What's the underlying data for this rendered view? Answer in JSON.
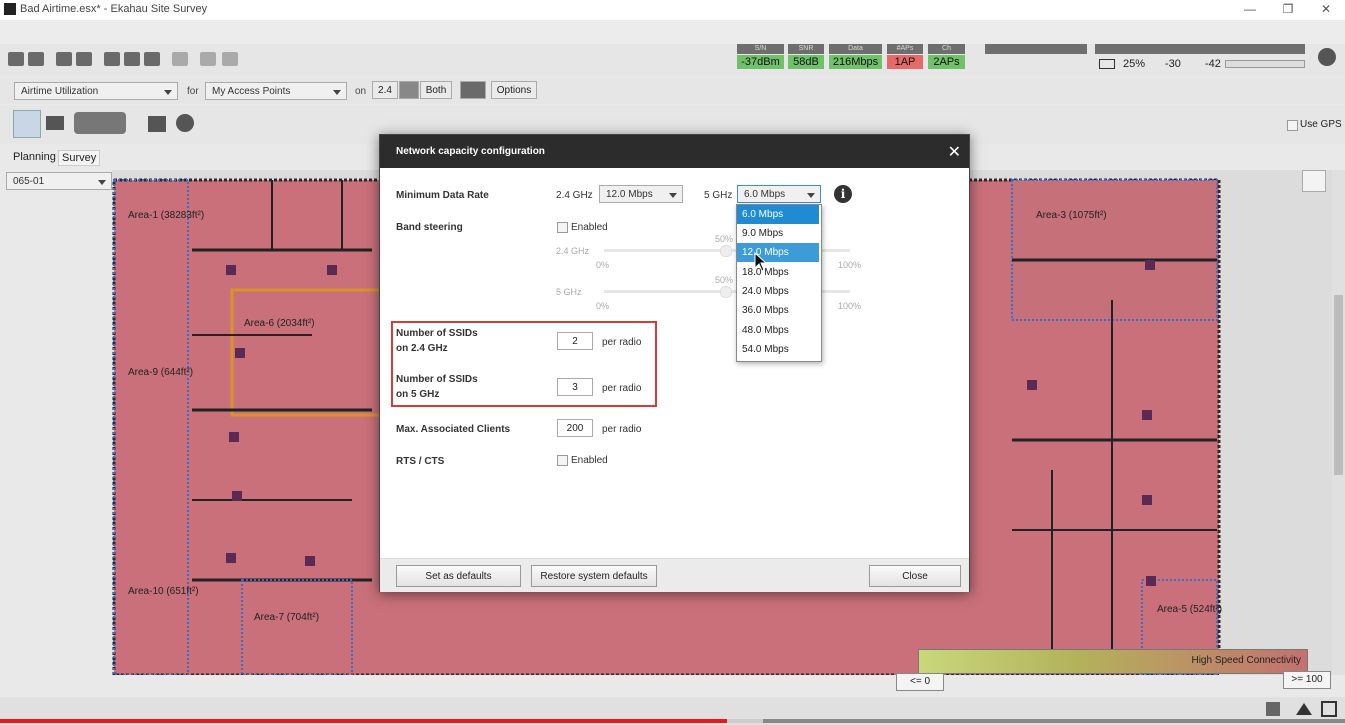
{
  "window": {
    "title": "Bad Airtime.esx* - Ekahau Site Survey",
    "minimize": "—",
    "maximize": "❐",
    "close": "✕"
  },
  "status": {
    "snr_label": "S/N",
    "snr_value": "-37dBm",
    "snr2_label": "SNR",
    "snr2_value": "58dB",
    "data_label": "Data",
    "data_value": "216Mbps",
    "aps_label": "#APs",
    "aps_value": "1AP",
    "ch_label": "Ch",
    "ch_value": "2APs",
    "right": {
      "battery": "25%",
      "rssi24": "-30",
      "rssi5": "-42"
    }
  },
  "filter": {
    "view": "Airtime Utilization",
    "for_label": "for",
    "scope": "My Access Points",
    "on_label": "on",
    "band_24": "2.4",
    "band_both": "Both",
    "options": "Options"
  },
  "use_gps": "Use GPS",
  "left": {
    "tab_planning": "Planning",
    "tab_survey": "Survey",
    "floor": "065-01",
    "add": "+"
  },
  "map": {
    "areas": [
      "Area-1 (38283ft²)",
      "Area-3 (1075ft²)",
      "Area-6 (2034ft²)",
      "Area-9 (644ft²)",
      "Area-10 (651ft²)",
      "Area-7 (704ft²)",
      "Area-5 (524ft²)"
    ]
  },
  "legend": {
    "label": "High Speed Connectivity",
    "low": "<= 0",
    "high": ">= 100"
  },
  "dialog": {
    "title": "Network capacity configuration",
    "close": "✕",
    "min_rate_label": "Minimum Data Rate",
    "band24": "2.4 GHz",
    "band24_value": "12.0 Mbps",
    "band5": "5 GHz",
    "band5_value": "6.0 Mbps",
    "info": "i",
    "band_steering_label": "Band steering",
    "enabled": "Enabled",
    "slider_24": "2.4 GHz",
    "slider_5": "5 GHz",
    "pct_0": "0%",
    "pct_50": "50%",
    "pct_100": "100%",
    "ssid24_label_1": "Number of SSIDs",
    "ssid24_label_2": "on 2.4 GHz",
    "ssid24_value": "2",
    "ssid5_label_1": "Number of SSIDs",
    "ssid5_label_2": "on 5 GHz",
    "ssid5_value": "3",
    "per_radio": "per radio",
    "max_clients_label": "Max. Associated Clients",
    "max_clients_value": "200",
    "rts_label": "RTS / CTS",
    "btn_defaults": "Set as defaults",
    "btn_restore": "Restore system defaults",
    "btn_close": "Close"
  },
  "dropdown": {
    "options": [
      "6.0 Mbps",
      "9.0 Mbps",
      "12.0 Mbps",
      "18.0 Mbps",
      "24.0 Mbps",
      "36.0 Mbps",
      "48.0 Mbps",
      "54.0 Mbps"
    ]
  },
  "colors": {
    "accent": "#1e8bd2",
    "map_fill": "#c9707a",
    "red_highlight": "#d83a3a"
  }
}
